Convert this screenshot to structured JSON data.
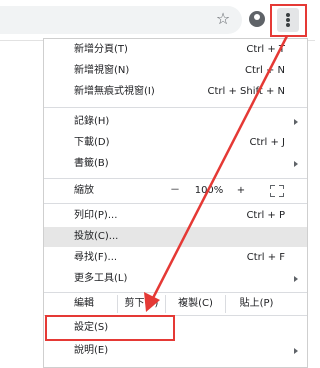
{
  "toolbar": {
    "star_icon": "star-outline-icon",
    "avatar_icon": "account-avatar-icon",
    "menu_icon": "three-dot-menu-icon"
  },
  "menu": {
    "new_tab": {
      "label": "新增分頁(T)",
      "shortcut": "Ctrl + T"
    },
    "new_window": {
      "label": "新增視窗(N)",
      "shortcut": "Ctrl + N"
    },
    "new_incognito": {
      "label": "新增無痕式視窗(I)",
      "shortcut": "Ctrl + Shift + N"
    },
    "history": {
      "label": "記錄(H)"
    },
    "downloads": {
      "label": "下載(D)",
      "shortcut": "Ctrl + J"
    },
    "bookmarks": {
      "label": "書籤(B)"
    },
    "zoom": {
      "label": "縮放",
      "minus": "－",
      "value": "100%",
      "plus": "+"
    },
    "print": {
      "label": "列印(P)...",
      "shortcut": "Ctrl + P"
    },
    "cast": {
      "label": "投放(C)..."
    },
    "find": {
      "label": "尋找(F)...",
      "shortcut": "Ctrl + F"
    },
    "more_tools": {
      "label": "更多工具(L)"
    },
    "edit": {
      "label": "編輯",
      "cut": "剪下(T)",
      "copy": "複製(C)",
      "paste": "貼上(P)"
    },
    "settings": {
      "label": "設定(S)"
    },
    "help": {
      "label": "說明(E)"
    }
  },
  "colors": {
    "annotation_red": "#e53935",
    "hover_gray": "#e6e6e6"
  }
}
